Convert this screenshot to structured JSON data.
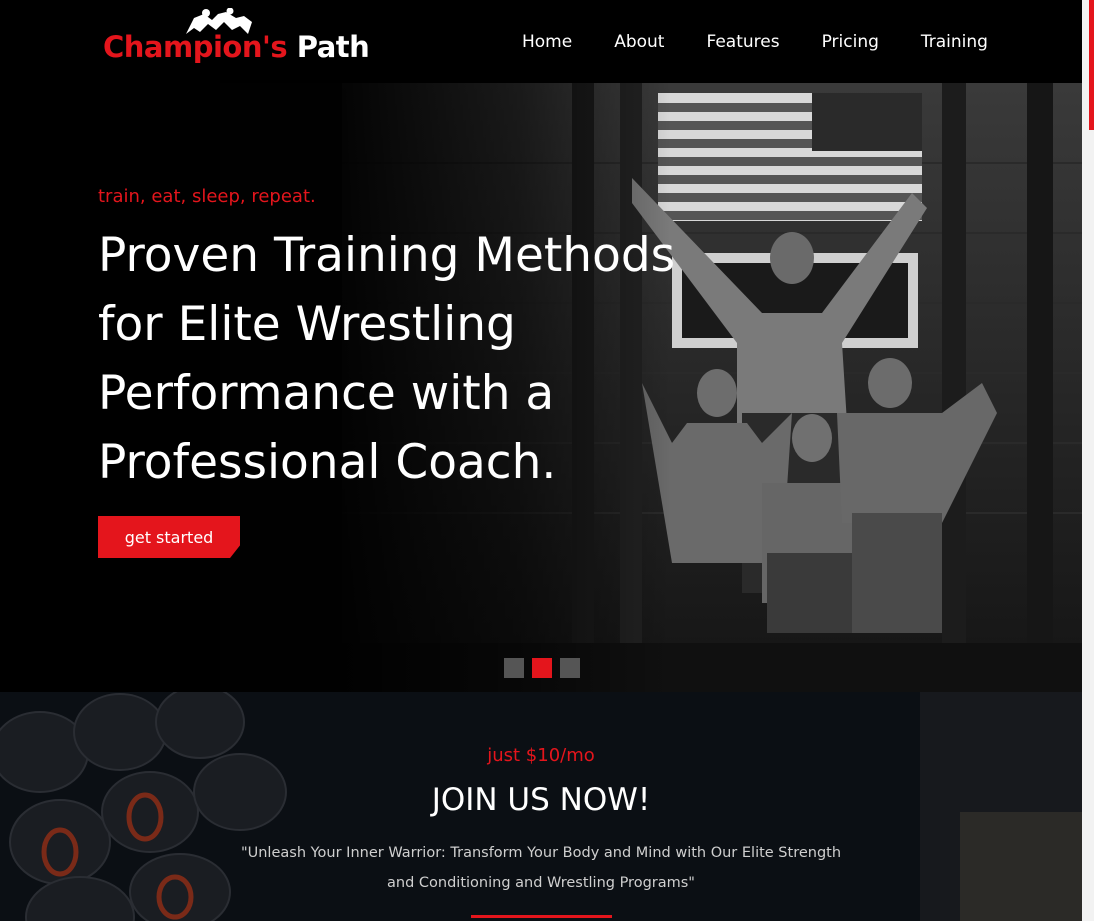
{
  "brand": {
    "name_red": "Champion's",
    "name_white": "Path",
    "logo_icon": "wrestlers-icon",
    "accent_color": "#e4151c"
  },
  "nav": {
    "items": [
      {
        "label": "Home"
      },
      {
        "label": "About"
      },
      {
        "label": "Features"
      },
      {
        "label": "Pricing"
      },
      {
        "label": "Training"
      }
    ]
  },
  "hero": {
    "tagline": "train, eat, sleep, repeat.",
    "headline": "Proven Training Methods for Elite Wrestling Performance with a Professional Coach.",
    "cta_label": "get started",
    "slides_total": 3,
    "active_slide": 2
  },
  "join": {
    "price": "just $10/mo",
    "title": "JOIN US NOW!",
    "quote": "\"Unleash Your Inner Warrior: Transform Your Body and Mind with Our Elite Strength and Conditioning and Wrestling Programs\""
  }
}
